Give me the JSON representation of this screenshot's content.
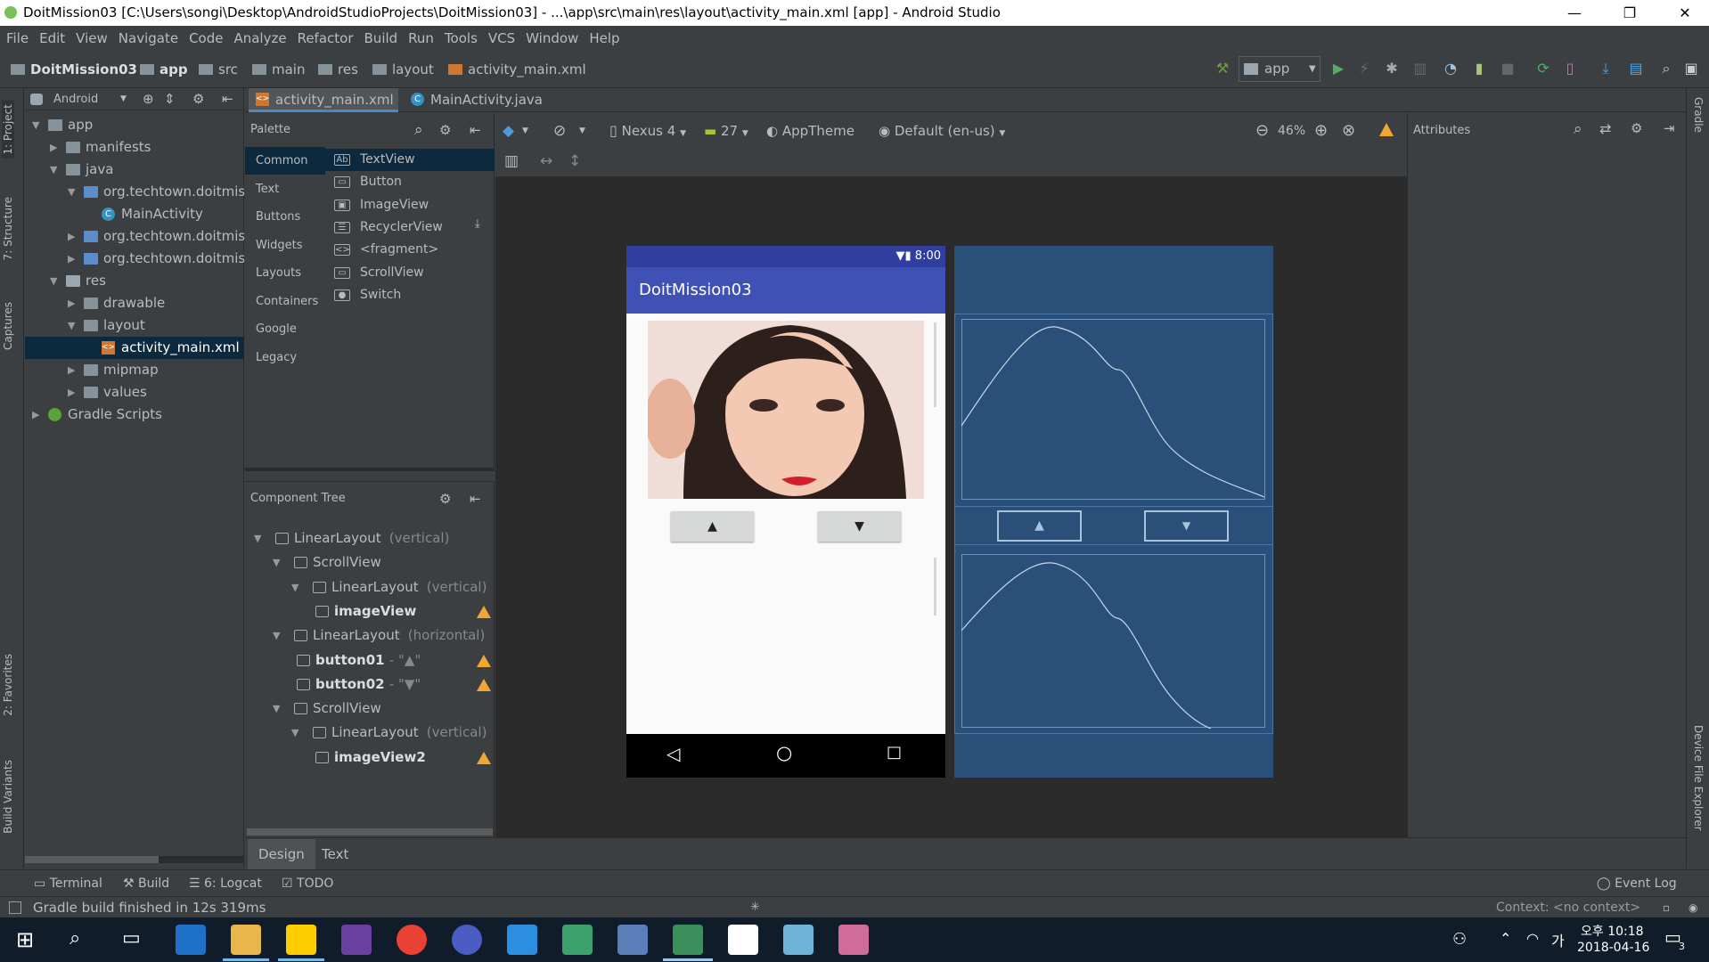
{
  "window": {
    "title": "DoitMission03 [C:\\Users\\songi\\Desktop\\AndroidStudioProjects\\DoitMission03] - ...\\app\\src\\main\\res\\layout\\activity_main.xml [app] - Android Studio",
    "controls": {
      "minimize": "—",
      "maximize": "❐",
      "close": "✕"
    }
  },
  "menu": [
    "File",
    "Edit",
    "View",
    "Navigate",
    "Code",
    "Analyze",
    "Refactor",
    "Build",
    "Run",
    "Tools",
    "VCS",
    "Window",
    "Help"
  ],
  "breadcrumb": [
    "DoitMission03",
    "app",
    "src",
    "main",
    "res",
    "layout",
    "activity_main.xml"
  ],
  "run_config": "app",
  "left_tabs": [
    "1: Project",
    "7: Structure",
    "Captures",
    "2: Favorites",
    "Build Variants"
  ],
  "right_tabs": [
    "Gradle",
    "Device File Explorer"
  ],
  "project": {
    "view_mode": "Android",
    "tree": [
      {
        "label": "app",
        "level": 0,
        "open": true,
        "icon": "folder"
      },
      {
        "label": "manifests",
        "level": 1,
        "open": false,
        "icon": "folder"
      },
      {
        "label": "java",
        "level": 1,
        "open": true,
        "icon": "folder"
      },
      {
        "label": "org.techtown.doitmis",
        "level": 2,
        "open": true,
        "icon": "package"
      },
      {
        "label": "MainActivity",
        "level": 3,
        "icon": "class"
      },
      {
        "label": "org.techtown.doitmis",
        "level": 2,
        "open": false,
        "icon": "package"
      },
      {
        "label": "org.techtown.doitmis",
        "level": 2,
        "open": false,
        "icon": "package"
      },
      {
        "label": "res",
        "level": 1,
        "open": true,
        "icon": "res"
      },
      {
        "label": "drawable",
        "level": 2,
        "open": false,
        "icon": "folder"
      },
      {
        "label": "layout",
        "level": 2,
        "open": true,
        "icon": "folder"
      },
      {
        "label": "activity_main.xml",
        "level": 3,
        "icon": "xml",
        "selected": true
      },
      {
        "label": "mipmap",
        "level": 2,
        "open": false,
        "icon": "folder"
      },
      {
        "label": "values",
        "level": 2,
        "open": false,
        "icon": "folder"
      },
      {
        "label": "Gradle Scripts",
        "level": 0,
        "open": false,
        "icon": "gradle"
      }
    ]
  },
  "editor_tabs": [
    {
      "label": "activity_main.xml",
      "active": true,
      "close": "×"
    },
    {
      "label": "MainActivity.java",
      "active": false
    }
  ],
  "palette": {
    "title": "Palette",
    "categories": [
      "Common",
      "Text",
      "Buttons",
      "Widgets",
      "Layouts",
      "Containers",
      "Google",
      "Legacy"
    ],
    "items": [
      {
        "icon": "Ab",
        "label": "TextView"
      },
      {
        "icon": "▭",
        "label": "Button"
      },
      {
        "icon": "▣",
        "label": "ImageView"
      },
      {
        "icon": "☰",
        "label": "RecyclerView"
      },
      {
        "icon": "<>",
        "label": "<fragment>"
      },
      {
        "icon": "▭",
        "label": "ScrollView"
      },
      {
        "icon": "●",
        "label": "Switch"
      }
    ]
  },
  "component_tree": {
    "title": "Component Tree",
    "rows": [
      {
        "name": "LinearLayout",
        "extra": "(vertical)",
        "level": 0,
        "bold": false
      },
      {
        "name": "ScrollView",
        "extra": "",
        "level": 1,
        "bold": false
      },
      {
        "name": "LinearLayout",
        "extra": "(vertical)",
        "level": 2,
        "bold": false
      },
      {
        "name": "imageView",
        "extra": "",
        "level": 3,
        "bold": true,
        "warn": true
      },
      {
        "name": "LinearLayout",
        "extra": "(horizontal)",
        "level": 1,
        "bold": false
      },
      {
        "name": "button01",
        "extra": "- \"▲\"",
        "level": 2,
        "bold": true,
        "warn": true
      },
      {
        "name": "button02",
        "extra": "- \"▼\"",
        "level": 2,
        "bold": true,
        "warn": true
      },
      {
        "name": "ScrollView",
        "extra": "",
        "level": 1,
        "bold": false
      },
      {
        "name": "LinearLayout",
        "extra": "(vertical)",
        "level": 2,
        "bold": false
      },
      {
        "name": "imageView2",
        "extra": "",
        "level": 3,
        "bold": true,
        "warn": true
      }
    ]
  },
  "design_toolbar": {
    "device": "Nexus 4",
    "api": "27",
    "theme": "AppTheme",
    "locale": "Default (en-us)",
    "zoom": "46%"
  },
  "attributes_title": "Attributes",
  "phone": {
    "time": "8:00",
    "app_title": "DoitMission03",
    "button_up": "▲",
    "button_down": "▼"
  },
  "blueprint": {
    "button_up": "▲",
    "button_down": "▼"
  },
  "bottom_tabs": [
    "Design",
    "Text"
  ],
  "tool_windows": {
    "terminal": "Terminal",
    "build": "Build",
    "logcat": "6: Logcat",
    "todo": "TODO",
    "event_log": "Event Log"
  },
  "status": {
    "message": "Gradle build finished in 12s 319ms",
    "context": "Context: <no context>"
  },
  "taskbar": {
    "time": "오후 10:18",
    "date": "2018-04-16",
    "ime": "가",
    "notif_count": "3"
  }
}
